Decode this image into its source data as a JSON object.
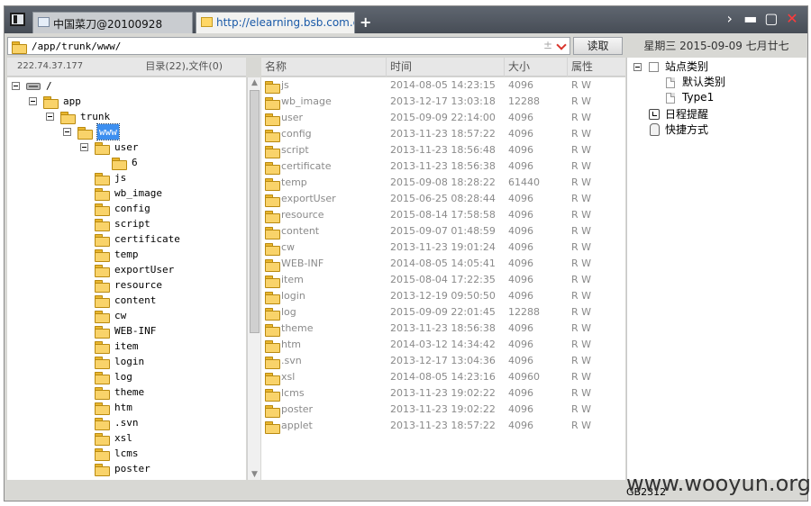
{
  "tabs": [
    {
      "label": "中国菜刀@20100928"
    },
    {
      "label": "http://elearning.bsb.com.cn/..."
    }
  ],
  "address": {
    "path": "/app/trunk/www/"
  },
  "read_button": "读取",
  "date": "星期三 2015-09-09 七月廿七",
  "left_info": {
    "ip": "222.74.37.177",
    "counts": "目录(22),文件(0)"
  },
  "tree": [
    {
      "label": "/",
      "icon": "drive-icon",
      "level": 0,
      "expanded": true
    },
    {
      "label": "app",
      "level": 1,
      "expanded": true
    },
    {
      "label": "trunk",
      "level": 2,
      "expanded": true
    },
    {
      "label": "www",
      "level": 3,
      "expanded": true,
      "selected": true
    },
    {
      "label": "user",
      "level": 4,
      "expanded": true
    },
    {
      "label": "6",
      "level": 5
    },
    {
      "label": "js",
      "level": 4
    },
    {
      "label": "wb_image",
      "level": 4
    },
    {
      "label": "config",
      "level": 4
    },
    {
      "label": "script",
      "level": 4
    },
    {
      "label": "certificate",
      "level": 4
    },
    {
      "label": "temp",
      "level": 4
    },
    {
      "label": "exportUser",
      "level": 4
    },
    {
      "label": "resource",
      "level": 4
    },
    {
      "label": "content",
      "level": 4
    },
    {
      "label": "cw",
      "level": 4
    },
    {
      "label": "WEB-INF",
      "level": 4
    },
    {
      "label": "item",
      "level": 4
    },
    {
      "label": "login",
      "level": 4
    },
    {
      "label": "log",
      "level": 4
    },
    {
      "label": "theme",
      "level": 4
    },
    {
      "label": "htm",
      "level": 4
    },
    {
      "label": ".svn",
      "level": 4
    },
    {
      "label": "xsl",
      "level": 4
    },
    {
      "label": "lcms",
      "level": 4
    },
    {
      "label": "poster",
      "level": 4
    }
  ],
  "file_columns": [
    "名称",
    "时间",
    "大小",
    "属性"
  ],
  "files": [
    {
      "name": "js",
      "time": "2014-08-05 14:23:15",
      "size": "4096",
      "attr": "R W"
    },
    {
      "name": "wb_image",
      "time": "2013-12-17 13:03:18",
      "size": "12288",
      "attr": "R W"
    },
    {
      "name": "user",
      "time": "2015-09-09 22:14:00",
      "size": "4096",
      "attr": "R W"
    },
    {
      "name": "config",
      "time": "2013-11-23 18:57:22",
      "size": "4096",
      "attr": "R W"
    },
    {
      "name": "script",
      "time": "2013-11-23 18:56:48",
      "size": "4096",
      "attr": "R W"
    },
    {
      "name": "certificate",
      "time": "2013-11-23 18:56:38",
      "size": "4096",
      "attr": "R W"
    },
    {
      "name": "temp",
      "time": "2015-09-08 18:28:22",
      "size": "61440",
      "attr": "R W"
    },
    {
      "name": "exportUser",
      "time": "2015-06-25 08:28:44",
      "size": "4096",
      "attr": "R W"
    },
    {
      "name": "resource",
      "time": "2015-08-14 17:58:58",
      "size": "4096",
      "attr": "R W"
    },
    {
      "name": "content",
      "time": "2015-09-07 01:48:59",
      "size": "4096",
      "attr": "R W"
    },
    {
      "name": "cw",
      "time": "2013-11-23 19:01:24",
      "size": "4096",
      "attr": "R W"
    },
    {
      "name": "WEB-INF",
      "time": "2014-08-05 14:05:41",
      "size": "4096",
      "attr": "R W"
    },
    {
      "name": "item",
      "time": "2015-08-04 17:22:35",
      "size": "4096",
      "attr": "R W"
    },
    {
      "name": "login",
      "time": "2013-12-19 09:50:50",
      "size": "4096",
      "attr": "R W"
    },
    {
      "name": "log",
      "time": "2015-09-09 22:01:45",
      "size": "12288",
      "attr": "R W"
    },
    {
      "name": "theme",
      "time": "2013-11-23 18:56:38",
      "size": "4096",
      "attr": "R W"
    },
    {
      "name": "htm",
      "time": "2014-03-12 14:34:42",
      "size": "4096",
      "attr": "R W"
    },
    {
      "name": ".svn",
      "time": "2013-12-17 13:04:36",
      "size": "4096",
      "attr": "R W"
    },
    {
      "name": "xsl",
      "time": "2014-08-05 14:23:16",
      "size": "40960",
      "attr": "R W"
    },
    {
      "name": "lcms",
      "time": "2013-11-23 19:02:22",
      "size": "4096",
      "attr": "R W"
    },
    {
      "name": "poster",
      "time": "2013-11-23 19:02:22",
      "size": "4096",
      "attr": "R W"
    },
    {
      "name": "applet",
      "time": "2013-11-23 18:57:22",
      "size": "4096",
      "attr": "R W"
    }
  ],
  "right_tree": [
    {
      "label": "站点类别",
      "icon": "checkbox-icon",
      "level": 0,
      "expanded": true
    },
    {
      "label": "默认类别",
      "icon": "document-icon",
      "level": 1
    },
    {
      "label": "Type1",
      "icon": "document-icon",
      "level": 1
    },
    {
      "label": "日程提醒",
      "icon": "clock-icon",
      "level": 0
    },
    {
      "label": "快捷方式",
      "icon": "hand-icon",
      "level": 0
    }
  ],
  "encoding": "GB2312",
  "watermark": "www.wooyun.org"
}
